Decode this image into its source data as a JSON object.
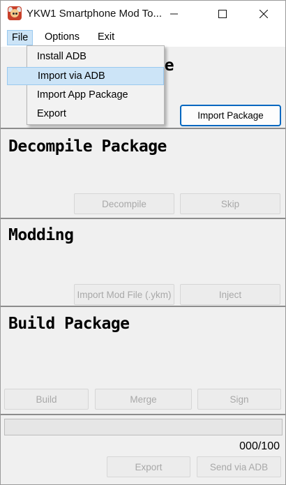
{
  "window": {
    "title": "YKW1 Smartphone Mod To...",
    "icon": "app-icon"
  },
  "menubar": {
    "items": [
      "File",
      "Options",
      "Exit"
    ],
    "open_menu": "File"
  },
  "file_menu": {
    "items": [
      "Install ADB",
      "Import via ADB",
      "Import App Package",
      "Export"
    ],
    "highlighted": "Import via ADB"
  },
  "import_section": {
    "title_visible_fragment": "age",
    "import_button": "Import Package"
  },
  "decompile_section": {
    "title": "Decompile Package",
    "decompile_button": "Decompile",
    "skip_button": "Skip"
  },
  "modding_section": {
    "title": "Modding",
    "import_mod_button": "Import Mod File (.ykm)",
    "inject_button": "Inject"
  },
  "build_section": {
    "title": "Build Package",
    "build_button": "Build",
    "merge_button": "Merge",
    "sign_button": "Sign"
  },
  "footer": {
    "progress": 0,
    "counter": "000/100",
    "export_button": "Export",
    "send_button": "Send via ADB"
  },
  "colors": {
    "accent": "#0067c0",
    "menu_highlight": "#cce4f7",
    "disabled_text": "#a8a8a8"
  }
}
